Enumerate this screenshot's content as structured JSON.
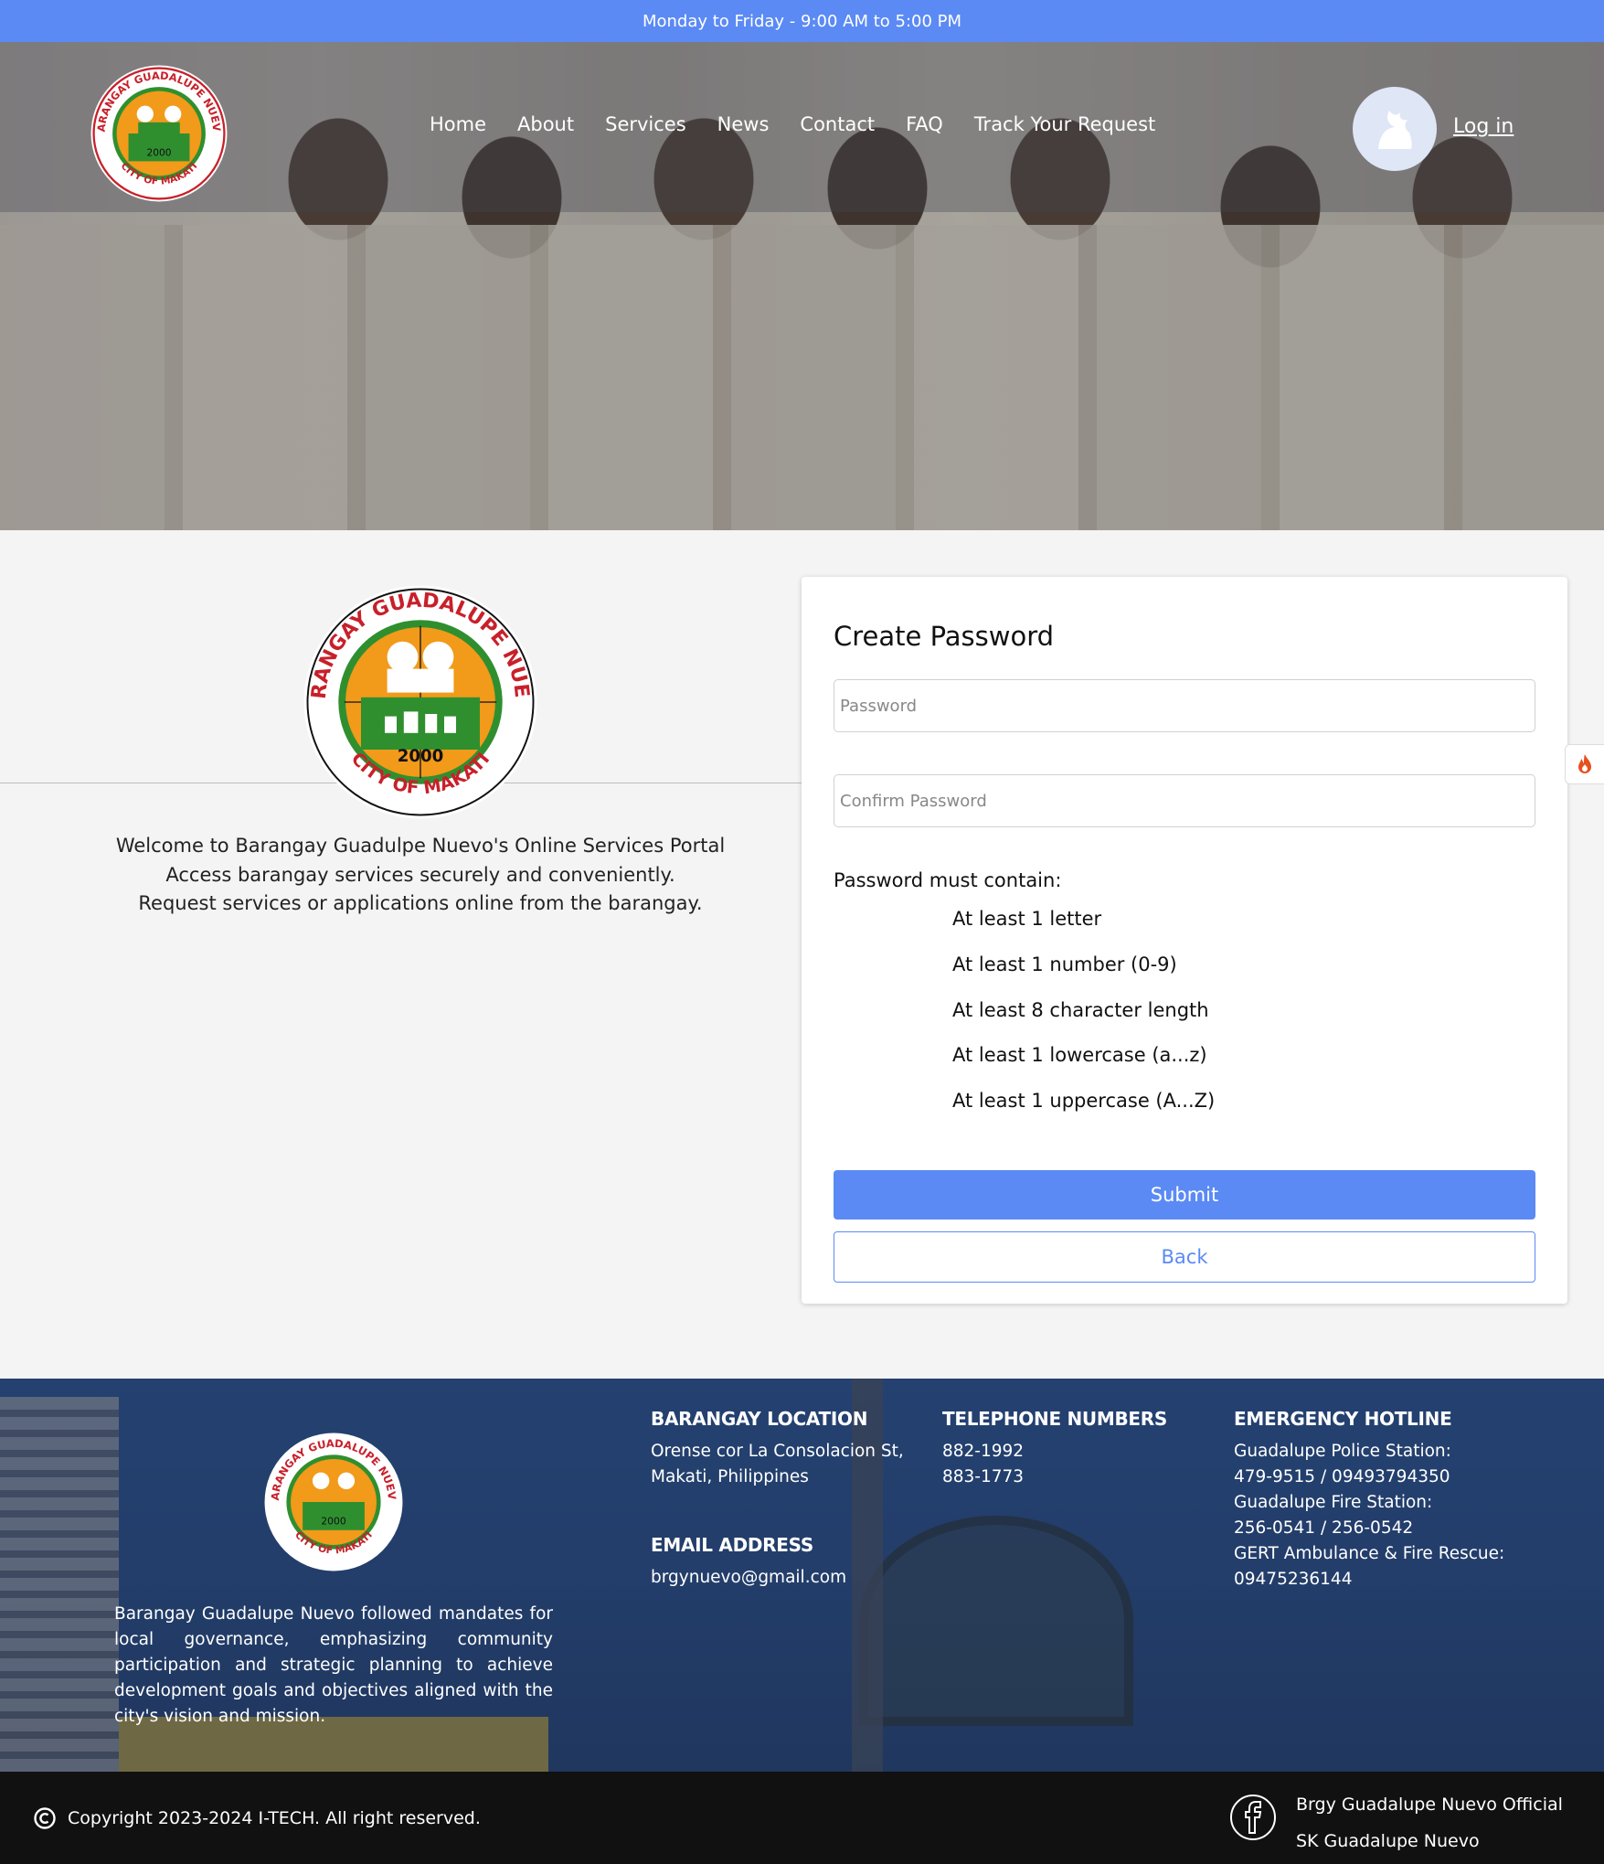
{
  "topbar": {
    "hours": "Monday to Friday - 9:00 AM to 5:00 PM"
  },
  "nav": {
    "logo": {
      "text_top": "BARANGAY GUADALUPE NUEVO",
      "year": "2000",
      "text_bottom": "CITY OF MAKATI"
    },
    "items": [
      "Home",
      "About",
      "Services",
      "News",
      "Contact",
      "FAQ",
      "Track Your Request"
    ],
    "login": "Log in"
  },
  "welcome": {
    "line1": "Welcome to Barangay Guadulpe Nuevo's Online Services Portal",
    "line2": "Access barangay services securely and conveniently.",
    "line3": "Request services or applications online from the barangay."
  },
  "form": {
    "title": "Create Password",
    "password_placeholder": "Password",
    "confirm_placeholder": "Confirm Password",
    "rules_title": "Password must contain:",
    "rules": [
      "At least 1 letter",
      "At least 1 number (0-9)",
      "At least 8 character length",
      "At least 1 lowercase (a...z)",
      "At least 1 uppercase (A...Z)"
    ],
    "submit": "Submit",
    "back": "Back"
  },
  "footer": {
    "about": "Barangay Guadalupe Nuevo followed mandates for local governance, emphasizing community participation and strategic planning to achieve development goals and objectives aligned with the city's vision and mission.",
    "location": {
      "heading": "BARANGAY LOCATION",
      "line1": "Orense cor La Consolacion St,",
      "line2": "Makati, Philippines"
    },
    "email": {
      "heading": "EMAIL ADDRESS",
      "value": "brgynuevo@gmail.com"
    },
    "telephone": {
      "heading": "TELEPHONE NUMBERS",
      "line1": "882-1992",
      "line2": "883-1773"
    },
    "emergency": {
      "heading": "EMERGENCY HOTLINE",
      "lines": [
        "Guadalupe Police Station:",
        "479-9515 / 09493794350",
        "Guadalupe Fire Station:",
        "256-0541 / 256-0542",
        "GERT Ambulance & Fire Rescue:",
        "09475236144"
      ]
    },
    "copyright": "Copyright 2023-2024 I-TECH. All right reserved.",
    "social": [
      "Brgy Guadalupe Nuevo Official",
      "SK Guadalupe Nuevo"
    ]
  },
  "colors": {
    "accent": "#5b8af5",
    "footer_bar": "#111111",
    "seal_green": "#2f8f2f",
    "seal_orange": "#f29a1a",
    "seal_red": "#c8202a"
  }
}
